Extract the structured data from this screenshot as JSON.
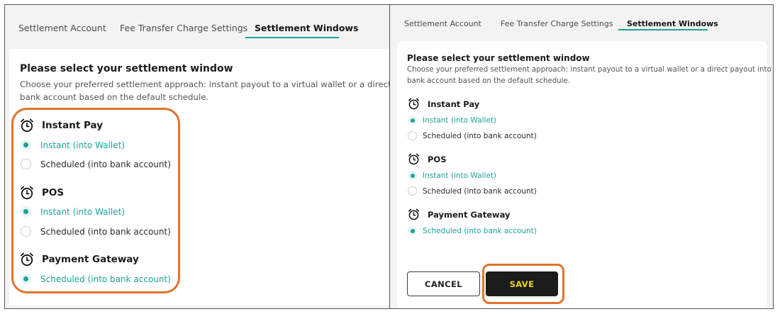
{
  "tabs": [
    "Settlement Account",
    "Fee Transfer Charge Settings",
    "Settlement Windows"
  ],
  "active_tab": "Settlement Windows",
  "card": {
    "title": "Please select your settlement window",
    "description_left_line1": "Choose your preferred settlement approach: instant payout to a virtual wallet or a direct payout into a",
    "description_left_line2": "bank account based on the default schedule.",
    "description_right_line1": "Choose your preferred settlement approach: instant payout to a virtual wallet or a direct payout into a",
    "description_right_line2": "bank account based on the default schedule."
  },
  "groups": [
    {
      "title": "Instant Pay",
      "icon": "alarm-clock-icon",
      "options": [
        {
          "label": "Instant (into Wallet)",
          "selected": true
        },
        {
          "label": "Scheduled (into bank account)",
          "selected": false
        }
      ]
    },
    {
      "title": "POS",
      "icon": "alarm-clock-icon",
      "options": [
        {
          "label": "Instant (into Wallet)",
          "selected": true
        },
        {
          "label": "Scheduled (into bank account)",
          "selected": false
        }
      ]
    },
    {
      "title": "Payment Gateway",
      "icon": "alarm-clock-icon",
      "options": [
        {
          "label": "Scheduled (into bank account)",
          "selected": true
        }
      ]
    }
  ],
  "buttons": {
    "cancel": "CANCEL",
    "save": "SAVE"
  },
  "colors": {
    "accent": "#1aa59a",
    "highlight": "#e3732f",
    "save_bg": "#1b1b1b",
    "save_text": "#f2d21b"
  }
}
